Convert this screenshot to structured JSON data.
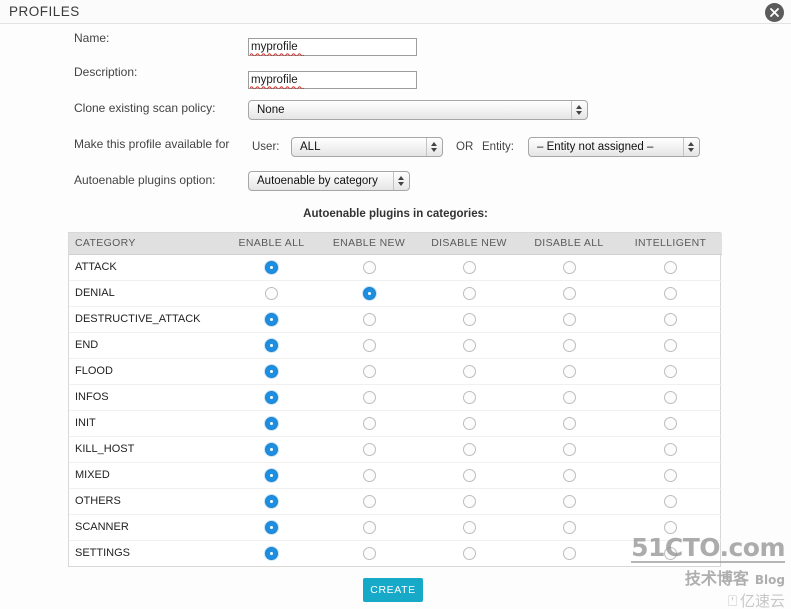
{
  "window": {
    "title": "PROFILES",
    "close_icon": "close-circle-icon"
  },
  "form": {
    "name_label": "Name:",
    "name_value": "myprofile",
    "name_placeholder": "",
    "description_label": "Description:",
    "description_value": "myprofile",
    "description_placeholder": "",
    "clone_label": "Clone existing scan policy:",
    "clone_value": "None",
    "clone_options": [
      "None"
    ],
    "available_label": "Make this profile available for",
    "user_label": "User:",
    "user_value": "ALL",
    "user_options": [
      "ALL"
    ],
    "or_label": "OR",
    "entity_label": "Entity:",
    "entity_value": "– Entity not assigned –",
    "entity_options": [
      "– Entity not assigned –"
    ],
    "autoenable_label": "Autoenable plugins option:",
    "autoenable_value": "Autoenable by category",
    "autoenable_options": [
      "Autoenable by category"
    ]
  },
  "table": {
    "caption": "Autoenable plugins in categories:",
    "headers": [
      "CATEGORY",
      "ENABLE ALL",
      "ENABLE NEW",
      "DISABLE NEW",
      "DISABLE ALL",
      "INTELLIGENT"
    ],
    "rows": [
      {
        "category": "ATTACK",
        "selected": 0
      },
      {
        "category": "DENIAL",
        "selected": 1
      },
      {
        "category": "DESTRUCTIVE_ATTACK",
        "selected": 0
      },
      {
        "category": "END",
        "selected": 0
      },
      {
        "category": "FLOOD",
        "selected": 0
      },
      {
        "category": "INFOS",
        "selected": 0
      },
      {
        "category": "INIT",
        "selected": 0
      },
      {
        "category": "KILL_HOST",
        "selected": 0
      },
      {
        "category": "MIXED",
        "selected": 0
      },
      {
        "category": "OTHERS",
        "selected": 0
      },
      {
        "category": "SCANNER",
        "selected": 0
      },
      {
        "category": "SETTINGS",
        "selected": 0
      }
    ]
  },
  "footer": {
    "create_label": "CREATE"
  },
  "watermark": {
    "site": "51CTO.com",
    "tagline_cn": "技术博客",
    "tagline_en": "Blog",
    "cloud_icon": "cloud-logo-icon",
    "cloud_text": "亿速云"
  },
  "colors": {
    "accent_button": "#17a9c8",
    "radio_selected": "#1e8fe0",
    "header_bg": "#e0e0e0"
  }
}
